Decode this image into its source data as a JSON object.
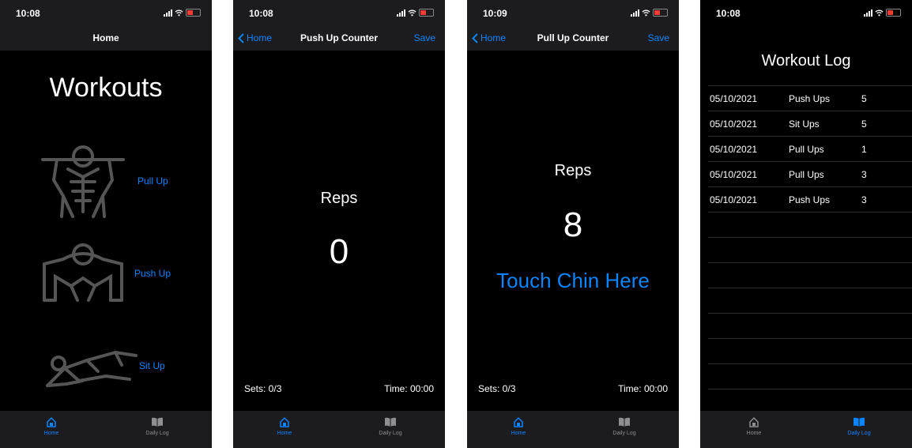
{
  "accent": "#0a84ff",
  "screens": {
    "home": {
      "status_time": "10:08",
      "nav_title": "Home",
      "heading": "Workouts",
      "workouts": [
        {
          "label": "Pull Up",
          "icon": "pull-up-figure-icon"
        },
        {
          "label": "Push Up",
          "icon": "push-up-figure-icon"
        },
        {
          "label": "Sit Up",
          "icon": "sit-up-figure-icon"
        }
      ]
    },
    "pushup": {
      "status_time": "10:08",
      "back_label": "Home",
      "nav_title": "Push Up Counter",
      "save_label": "Save",
      "reps_label": "Reps",
      "reps_value": "0",
      "sets": "Sets: 0/3",
      "time": "Time: 00:00"
    },
    "pullup": {
      "status_time": "10:09",
      "back_label": "Home",
      "nav_title": "Pull Up Counter",
      "save_label": "Save",
      "reps_label": "Reps",
      "reps_value": "8",
      "touch_label": "Touch Chin Here",
      "sets": "Sets: 0/3",
      "time": "Time: 00:00"
    },
    "log": {
      "status_time": "10:08",
      "title": "Workout Log",
      "rows": [
        {
          "date": "05/10/2021",
          "exercise": "Push Ups",
          "count": "5"
        },
        {
          "date": "05/10/2021",
          "exercise": "Sit Ups",
          "count": "5"
        },
        {
          "date": "05/10/2021",
          "exercise": "Pull Ups",
          "count": "1"
        },
        {
          "date": "05/10/2021",
          "exercise": "Pull Ups",
          "count": "3"
        },
        {
          "date": "05/10/2021",
          "exercise": "Push Ups",
          "count": "3"
        }
      ]
    }
  },
  "tabbar": {
    "home_label": "Home",
    "log_label": "Daily Log"
  }
}
